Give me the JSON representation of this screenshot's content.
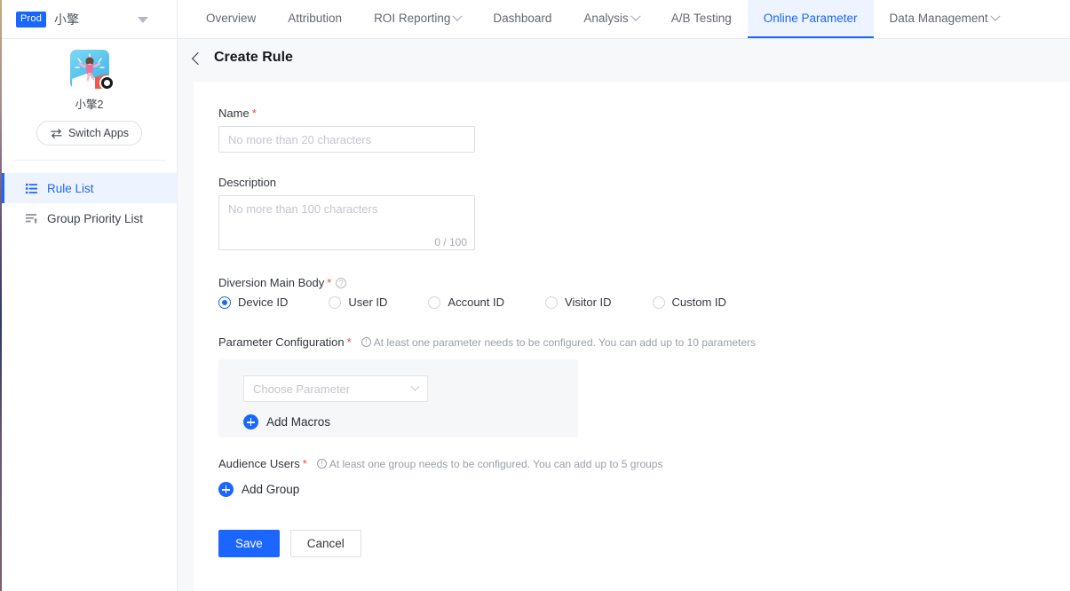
{
  "topnav": {
    "env_badge": "Prod",
    "brand_name": "小擎",
    "caret_icon": "caret-down-icon",
    "tabs": [
      {
        "label": "Overview",
        "has_caret": false,
        "active": false
      },
      {
        "label": "Attribution",
        "has_caret": false,
        "active": false
      },
      {
        "label": "ROI Reporting",
        "has_caret": true,
        "active": false
      },
      {
        "label": "Dashboard",
        "has_caret": false,
        "active": false
      },
      {
        "label": "Analysis",
        "has_caret": true,
        "active": false
      },
      {
        "label": "A/B Testing",
        "has_caret": false,
        "active": false
      },
      {
        "label": "Online Parameter",
        "has_caret": false,
        "active": true
      },
      {
        "label": "Data Management",
        "has_caret": true,
        "active": false
      }
    ]
  },
  "sidebar": {
    "app_avatar_icon": "app-avatar-illustration",
    "app_badge_icon": "platform-badge-icon",
    "app_name": "小擎2",
    "switch_apps_label": "Switch Apps",
    "switch_apps_icon": "swap-arrows-icon",
    "items": [
      {
        "label": "Rule List",
        "icon": "list-icon",
        "active": true
      },
      {
        "label": "Group Priority List",
        "icon": "list-sort-up-icon",
        "active": false
      }
    ]
  },
  "page": {
    "back_icon": "chevron-left-icon",
    "title": "Create Rule"
  },
  "form": {
    "name": {
      "label": "Name",
      "required_mark": "*",
      "placeholder": "No more than 20 characters",
      "value": ""
    },
    "description": {
      "label": "Description",
      "placeholder": "No more than 100 characters",
      "value": "",
      "counter": "0 / 100"
    },
    "diversion_main_body": {
      "label": "Diversion Main Body",
      "required_mark": "*",
      "help_icon": "question-circle-icon",
      "help_glyph": "?",
      "options": [
        {
          "label": "Device ID",
          "selected": true
        },
        {
          "label": "User ID",
          "selected": false
        },
        {
          "label": "Account ID",
          "selected": false
        },
        {
          "label": "Visitor ID",
          "selected": false
        },
        {
          "label": "Custom ID",
          "selected": false
        }
      ]
    },
    "parameter_configuration": {
      "label": "Parameter Configuration",
      "required_mark": "*",
      "hint_icon": "info-circle-icon",
      "hint_glyph": "!",
      "hint": "At least one parameter needs to be configured. You can add up to 10 parameters",
      "select_placeholder": "Choose Parameter",
      "select_caret_icon": "chevron-down-icon",
      "add_macros_label": "Add Macros",
      "add_macros_icon": "plus-circle-icon"
    },
    "audience_users": {
      "label": "Audience Users",
      "required_mark": "*",
      "hint_icon": "info-circle-icon",
      "hint_glyph": "!",
      "hint": "At least one group needs to be configured. You can add up to 5 groups",
      "add_group_label": "Add Group",
      "add_group_icon": "plus-circle-icon"
    },
    "actions": {
      "save_label": "Save",
      "cancel_label": "Cancel"
    }
  },
  "colors": {
    "accent": "#1a66ff",
    "accent_bg": "#eef4ff",
    "required": "#f5483b",
    "page_bg": "#f7f8fa",
    "panel_bg": "#f6f7f9"
  }
}
